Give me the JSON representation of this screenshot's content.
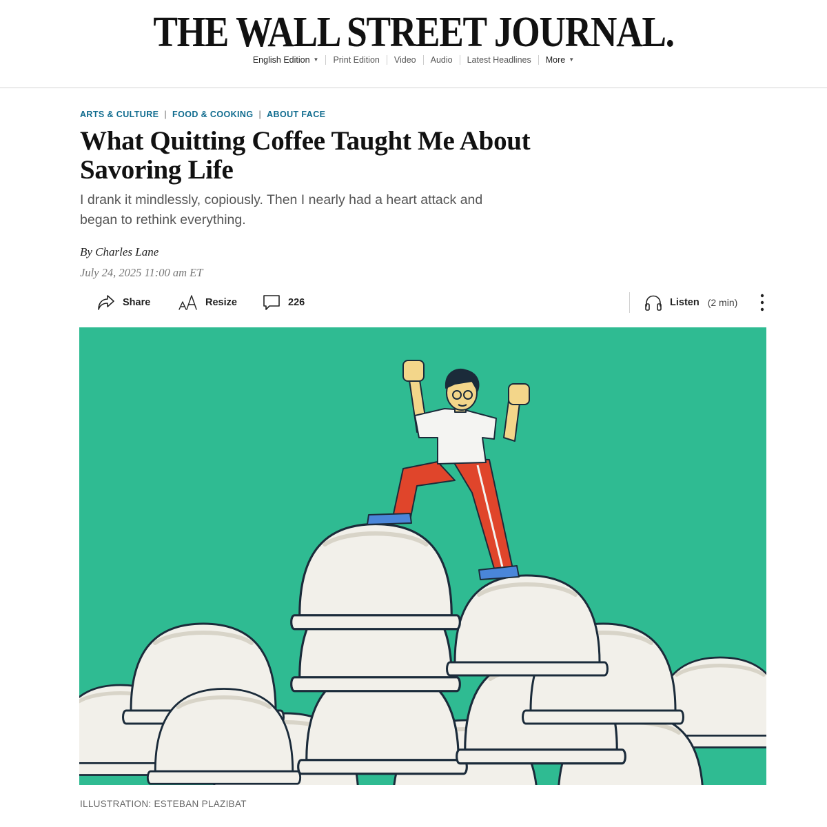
{
  "masthead": {
    "logo": "THE WALL STREET JOURNAL.",
    "nav": [
      {
        "label": "English Edition",
        "dropdown": true
      },
      {
        "label": "Print Edition"
      },
      {
        "label": "Video"
      },
      {
        "label": "Audio"
      },
      {
        "label": "Latest Headlines"
      },
      {
        "label": "More",
        "dropdown": true
      }
    ]
  },
  "article": {
    "breadcrumbs": [
      "ARTS & CULTURE",
      "FOOD & COOKING",
      "ABOUT FACE"
    ],
    "headline": "What Quitting Coffee Taught Me About Savoring Life",
    "dek": "I drank it mindlessly, copiously. Then I nearly had a heart attack and began to rethink everything.",
    "byline_prefix": "By ",
    "author": "Charles Lane",
    "date": "July 24, 2025 11:00 am ET"
  },
  "toolbar": {
    "share": {
      "label": "Share",
      "icon": "share-arrow-icon"
    },
    "resize": {
      "label": "Resize",
      "icon": "resize-text-icon"
    },
    "comments": {
      "count": "226",
      "icon": "comment-bubble-icon"
    },
    "listen": {
      "label": "Listen",
      "duration": "(2 min)",
      "icon": "headphones-icon"
    },
    "more": {
      "icon": "vertical-ellipsis-icon"
    }
  },
  "image": {
    "caption": "ILLUSTRATION: ESTEBAN PLAZIBAT",
    "colors": {
      "background": "#2fbb92",
      "cup": "#f2f0ea",
      "shirt": "#f4f4f2",
      "pants": "#e0452b",
      "skin": "#f3d68a",
      "shoes": "#4a86d9",
      "outline": "#1b2b3a"
    }
  },
  "colors": {
    "section_link": "#0f6b8e",
    "dek": "#555555",
    "date": "#777777"
  }
}
